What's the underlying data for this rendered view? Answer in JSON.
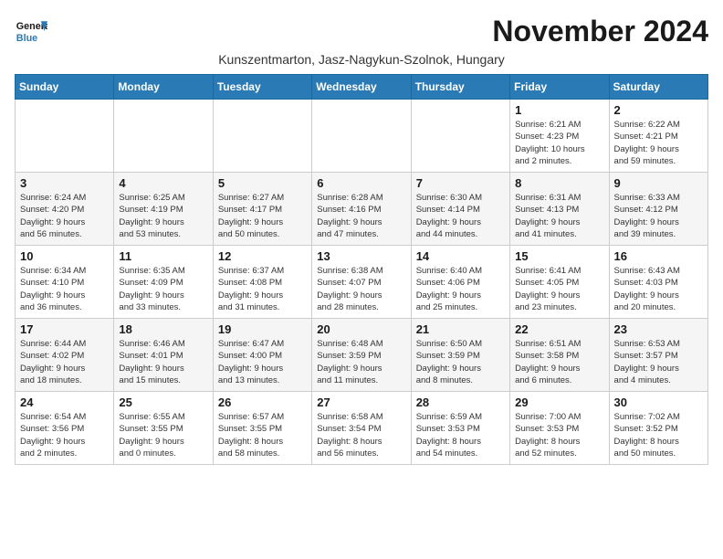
{
  "header": {
    "logo_line1": "General",
    "logo_line2": "Blue",
    "month_title": "November 2024",
    "subtitle": "Kunszentmarton, Jasz-Nagykun-Szolnok, Hungary"
  },
  "days_of_week": [
    "Sunday",
    "Monday",
    "Tuesday",
    "Wednesday",
    "Thursday",
    "Friday",
    "Saturday"
  ],
  "weeks": [
    [
      {
        "day": "",
        "info": ""
      },
      {
        "day": "",
        "info": ""
      },
      {
        "day": "",
        "info": ""
      },
      {
        "day": "",
        "info": ""
      },
      {
        "day": "",
        "info": ""
      },
      {
        "day": "1",
        "info": "Sunrise: 6:21 AM\nSunset: 4:23 PM\nDaylight: 10 hours\nand 2 minutes."
      },
      {
        "day": "2",
        "info": "Sunrise: 6:22 AM\nSunset: 4:21 PM\nDaylight: 9 hours\nand 59 minutes."
      }
    ],
    [
      {
        "day": "3",
        "info": "Sunrise: 6:24 AM\nSunset: 4:20 PM\nDaylight: 9 hours\nand 56 minutes."
      },
      {
        "day": "4",
        "info": "Sunrise: 6:25 AM\nSunset: 4:19 PM\nDaylight: 9 hours\nand 53 minutes."
      },
      {
        "day": "5",
        "info": "Sunrise: 6:27 AM\nSunset: 4:17 PM\nDaylight: 9 hours\nand 50 minutes."
      },
      {
        "day": "6",
        "info": "Sunrise: 6:28 AM\nSunset: 4:16 PM\nDaylight: 9 hours\nand 47 minutes."
      },
      {
        "day": "7",
        "info": "Sunrise: 6:30 AM\nSunset: 4:14 PM\nDaylight: 9 hours\nand 44 minutes."
      },
      {
        "day": "8",
        "info": "Sunrise: 6:31 AM\nSunset: 4:13 PM\nDaylight: 9 hours\nand 41 minutes."
      },
      {
        "day": "9",
        "info": "Sunrise: 6:33 AM\nSunset: 4:12 PM\nDaylight: 9 hours\nand 39 minutes."
      }
    ],
    [
      {
        "day": "10",
        "info": "Sunrise: 6:34 AM\nSunset: 4:10 PM\nDaylight: 9 hours\nand 36 minutes."
      },
      {
        "day": "11",
        "info": "Sunrise: 6:35 AM\nSunset: 4:09 PM\nDaylight: 9 hours\nand 33 minutes."
      },
      {
        "day": "12",
        "info": "Sunrise: 6:37 AM\nSunset: 4:08 PM\nDaylight: 9 hours\nand 31 minutes."
      },
      {
        "day": "13",
        "info": "Sunrise: 6:38 AM\nSunset: 4:07 PM\nDaylight: 9 hours\nand 28 minutes."
      },
      {
        "day": "14",
        "info": "Sunrise: 6:40 AM\nSunset: 4:06 PM\nDaylight: 9 hours\nand 25 minutes."
      },
      {
        "day": "15",
        "info": "Sunrise: 6:41 AM\nSunset: 4:05 PM\nDaylight: 9 hours\nand 23 minutes."
      },
      {
        "day": "16",
        "info": "Sunrise: 6:43 AM\nSunset: 4:03 PM\nDaylight: 9 hours\nand 20 minutes."
      }
    ],
    [
      {
        "day": "17",
        "info": "Sunrise: 6:44 AM\nSunset: 4:02 PM\nDaylight: 9 hours\nand 18 minutes."
      },
      {
        "day": "18",
        "info": "Sunrise: 6:46 AM\nSunset: 4:01 PM\nDaylight: 9 hours\nand 15 minutes."
      },
      {
        "day": "19",
        "info": "Sunrise: 6:47 AM\nSunset: 4:00 PM\nDaylight: 9 hours\nand 13 minutes."
      },
      {
        "day": "20",
        "info": "Sunrise: 6:48 AM\nSunset: 3:59 PM\nDaylight: 9 hours\nand 11 minutes."
      },
      {
        "day": "21",
        "info": "Sunrise: 6:50 AM\nSunset: 3:59 PM\nDaylight: 9 hours\nand 8 minutes."
      },
      {
        "day": "22",
        "info": "Sunrise: 6:51 AM\nSunset: 3:58 PM\nDaylight: 9 hours\nand 6 minutes."
      },
      {
        "day": "23",
        "info": "Sunrise: 6:53 AM\nSunset: 3:57 PM\nDaylight: 9 hours\nand 4 minutes."
      }
    ],
    [
      {
        "day": "24",
        "info": "Sunrise: 6:54 AM\nSunset: 3:56 PM\nDaylight: 9 hours\nand 2 minutes."
      },
      {
        "day": "25",
        "info": "Sunrise: 6:55 AM\nSunset: 3:55 PM\nDaylight: 9 hours\nand 0 minutes."
      },
      {
        "day": "26",
        "info": "Sunrise: 6:57 AM\nSunset: 3:55 PM\nDaylight: 8 hours\nand 58 minutes."
      },
      {
        "day": "27",
        "info": "Sunrise: 6:58 AM\nSunset: 3:54 PM\nDaylight: 8 hours\nand 56 minutes."
      },
      {
        "day": "28",
        "info": "Sunrise: 6:59 AM\nSunset: 3:53 PM\nDaylight: 8 hours\nand 54 minutes."
      },
      {
        "day": "29",
        "info": "Sunrise: 7:00 AM\nSunset: 3:53 PM\nDaylight: 8 hours\nand 52 minutes."
      },
      {
        "day": "30",
        "info": "Sunrise: 7:02 AM\nSunset: 3:52 PM\nDaylight: 8 hours\nand 50 minutes."
      }
    ]
  ]
}
